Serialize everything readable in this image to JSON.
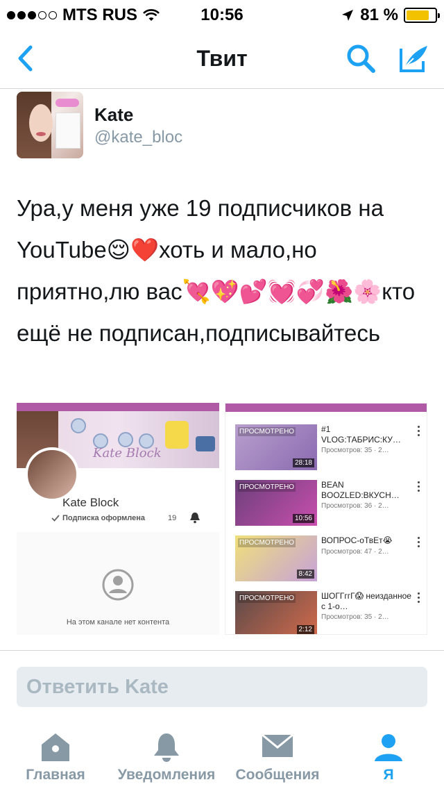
{
  "status_bar": {
    "carrier": "MTS RUS",
    "time": "10:56",
    "battery_text": "81 %",
    "battery_level": 0.81,
    "signal_bars": 3,
    "signal_total": 5
  },
  "nav": {
    "title": "Твит",
    "back_icon": "chevron-left-icon",
    "search_icon": "search-icon",
    "compose_icon": "compose-icon",
    "accent": "#1da1f2"
  },
  "author": {
    "name": "Kate",
    "handle": "@kate_bloc"
  },
  "tweet": {
    "text": "Ура,у меня уже 19 подписчиков на YouTube😌❤️хоть и мало,но приятно,лю вас💘💖💕💓💞🌺🌸кто ещё не подписан,подписывайтесь"
  },
  "media": {
    "channel": {
      "banner_text": "Kate Block",
      "name": "Kate Block",
      "subscription": "Подписка оформлена",
      "subscribers": "19",
      "empty_message": "На этом канале нет контента"
    },
    "videos": [
      {
        "tag": "ПРОСМОТРЕНО",
        "duration": "28:18",
        "title": "#1 VLOG:ТАБРИС:КУ…",
        "views": "Просмотров: 35 · 2…",
        "thumb_colors": [
          "#b89fcd",
          "#8a6ab0"
        ]
      },
      {
        "tag": "ПРОСМОТРЕНО",
        "duration": "10:56",
        "title": "BEAN BOOZLED:ВКУСН…",
        "views": "Просмотров: 36 · 2…",
        "thumb_colors": [
          "#6b3f7a",
          "#c94fae"
        ]
      },
      {
        "tag": "ПРОСМОТРЕНО",
        "duration": "8:42",
        "title": "ВОПРОС-оТвЕт😭",
        "views": "Просмотров: 47 · 2…",
        "thumb_colors": [
          "#f0e07a",
          "#c6a1d9"
        ]
      },
      {
        "tag": "ПРОСМОТРЕНО",
        "duration": "2:12",
        "title": "ШОГГггГ😱 неизданное с 1-о…",
        "views": "Просмотров: 35 · 2…",
        "thumb_colors": [
          "#5a4a4a",
          "#d26a4b"
        ]
      }
    ]
  },
  "reply": {
    "placeholder": "Ответить Kate"
  },
  "tabs": [
    {
      "label": "Главная",
      "icon": "home-icon",
      "active": false
    },
    {
      "label": "Уведомления",
      "icon": "bell-icon",
      "active": false
    },
    {
      "label": "Сообщения",
      "icon": "envelope-icon",
      "active": false
    },
    {
      "label": "Я",
      "icon": "person-icon",
      "active": true
    }
  ]
}
